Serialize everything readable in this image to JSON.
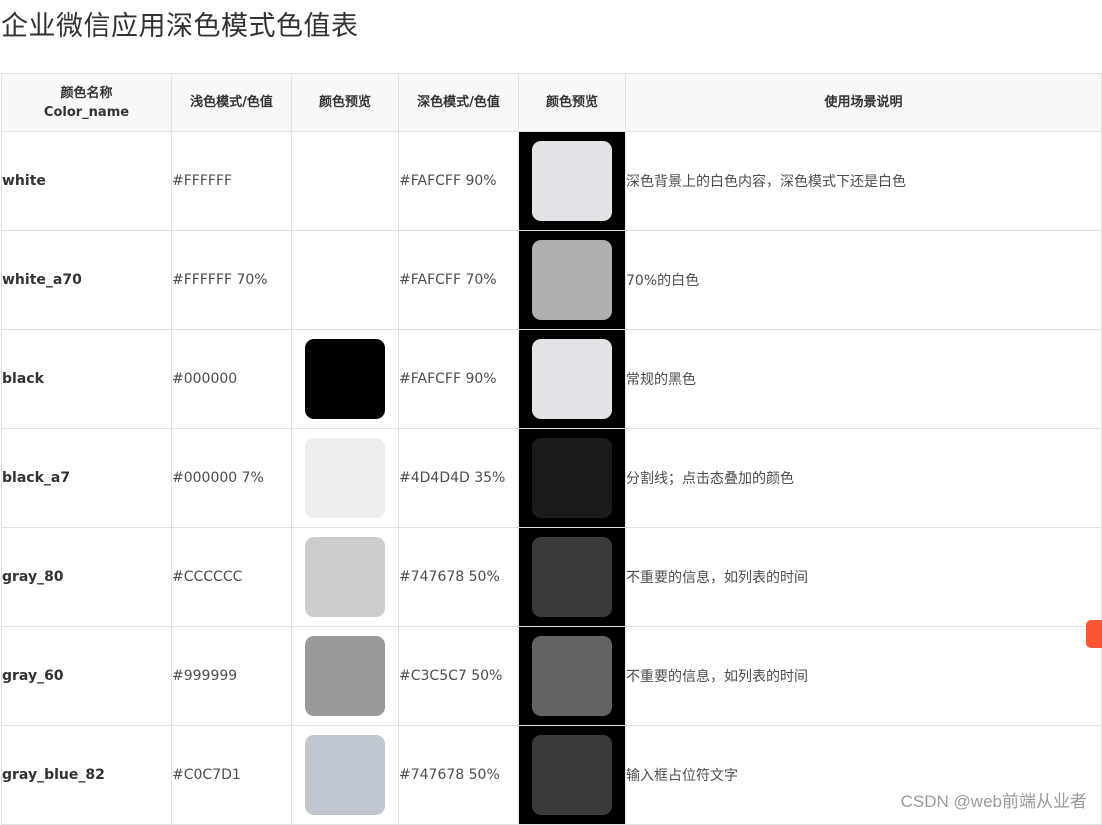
{
  "page": {
    "title": "企业微信应用深色模式色值表"
  },
  "table": {
    "headers": {
      "name_line1": "颜色名称",
      "name_line2": "Color_name",
      "light": "浅色模式/色值",
      "light_preview": "颜色预览",
      "dark": "深色模式/色值",
      "dark_preview": "颜色预览",
      "usage": "使用场景说明"
    },
    "rows": [
      {
        "name": "white",
        "light": "#FFFFFF",
        "light_swatch": "#FFFFFF",
        "dark": "#FAFCFF 90%",
        "dark_swatch": "#E1E3E6",
        "usage": "深色背景上的白色内容，深色模式下还是白色"
      },
      {
        "name": "white_a70",
        "light": "#FFFFFF 70%",
        "light_swatch": "#FFFFFF",
        "dark": "#FAFCFF 70%",
        "dark_swatch": "#AFB0B2",
        "usage": "70%的白色"
      },
      {
        "name": "black",
        "light": "#000000",
        "light_swatch": "#000000",
        "dark": "#FAFCFF 90%",
        "dark_swatch": "#E1E3E6",
        "usage": "常规的黑色"
      },
      {
        "name": "black_a7",
        "light": "#000000 7%",
        "light_swatch": "#EDEDED",
        "dark": "#4D4D4D 35%",
        "dark_swatch": "#1B1B1B",
        "usage": "分割线；点击态叠加的颜色"
      },
      {
        "name": "gray_80",
        "light": "#CCCCCC",
        "light_swatch": "#CCCCCC",
        "dark": "#747678 50%",
        "dark_swatch": "#3A3B3C",
        "usage": "不重要的信息，如列表的时间"
      },
      {
        "name": "gray_60",
        "light": "#999999",
        "light_swatch": "#999999",
        "dark": "#C3C5C7 50%",
        "dark_swatch": "#626364",
        "usage": "不重要的信息，如列表的时间"
      },
      {
        "name": "gray_blue_82",
        "light": "#C0C7D1",
        "light_swatch": "#C0C7D1",
        "dark": "#747678 50%",
        "dark_swatch": "#3A3B3C",
        "usage": "输入框占位符文字"
      }
    ]
  },
  "watermark": "CSDN @web前端从业者"
}
